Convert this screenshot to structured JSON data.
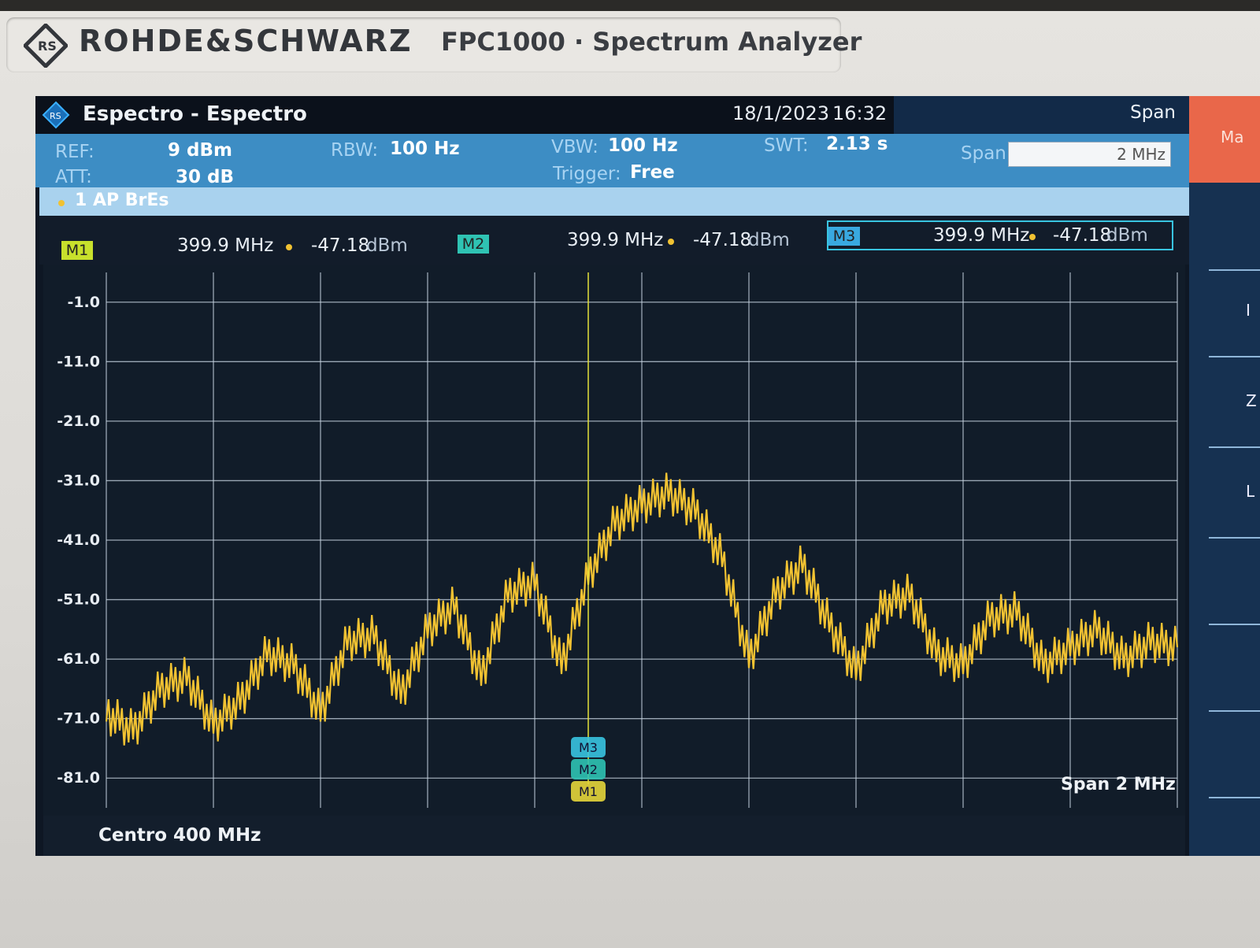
{
  "brand": {
    "name": "ROHDE&SCHWARZ",
    "model": "FPC1000 · Spectrum Analyzer"
  },
  "titlebar": {
    "title": "Espectro - Espectro",
    "date": "18/1/2023",
    "time": "16:32",
    "softkey_title": "Span"
  },
  "params": {
    "ref_label": "REF:",
    "ref_value": "9 dBm",
    "att_label": "ATT:",
    "att_value": "30 dB",
    "rbw_label": "RBW:",
    "rbw_value": "100 Hz",
    "vbw_label": "VBW:",
    "vbw_value": "100 Hz",
    "trigger_label": "Trigger:",
    "trigger_value": "Free",
    "swt_label": "SWT:",
    "swt_value": "2.13 s",
    "span_label": "Span",
    "span_value": "2 MHz"
  },
  "trace": {
    "label": "1 AP  BrEs",
    "color": "#f1c232"
  },
  "markers": [
    {
      "id": "M1",
      "freq": "399.9 MHz",
      "level": "-47.18",
      "unit": "dBm",
      "color": "#c8e02c"
    },
    {
      "id": "M2",
      "freq": "399.9 MHz",
      "level": "-47.18",
      "unit": "dBm",
      "color": "#2fc3b3"
    },
    {
      "id": "M3",
      "freq": "399.9 MHz",
      "level": "-47.18",
      "unit": "dBm",
      "color": "#39a9e0"
    }
  ],
  "side_tab": "Ma",
  "side_letters": [
    "I",
    "Z",
    "L"
  ],
  "footer": {
    "center": "Centro 400 MHz",
    "span": "Span 2 MHz"
  },
  "chart_data": {
    "type": "line",
    "y_ticks": [
      "-1.0",
      "-11.0",
      "-21.0",
      "-31.0",
      "-41.0",
      "-51.0",
      "-61.0",
      "-71.0",
      "-81.0"
    ],
    "ylim": [
      -86,
      4
    ],
    "xlim": [
      399,
      401
    ],
    "x_unit": "MHz",
    "y_unit": "dBm",
    "grid": true,
    "series": [
      {
        "x": [
          399.0,
          399.05,
          399.1,
          399.15,
          399.2,
          399.25,
          399.3,
          399.35,
          399.4,
          399.45,
          399.5,
          399.55,
          399.6,
          399.65,
          399.7,
          399.75,
          399.8,
          399.85,
          399.9,
          399.95,
          400.0,
          400.05,
          400.1,
          400.15,
          400.2,
          400.25,
          400.3,
          400.35,
          400.4,
          400.45,
          400.5,
          400.55,
          400.6,
          400.65,
          400.7,
          400.75,
          400.8,
          400.85,
          400.9,
          400.95,
          401.0
        ],
        "y": [
          -70,
          -73,
          -66,
          -64,
          -72,
          -68,
          -60,
          -62,
          -70,
          -58,
          -57,
          -67,
          -56,
          -52,
          -64,
          -50,
          -48,
          -62,
          -47,
          -38,
          -35,
          -33,
          -36,
          -44,
          -61,
          -50,
          -45,
          -55,
          -63,
          -52,
          -50,
          -60,
          -62,
          -54,
          -53,
          -62,
          -59,
          -56,
          -61,
          -58,
          -59
        ]
      }
    ],
    "markers_x": [
      399.9
    ]
  }
}
